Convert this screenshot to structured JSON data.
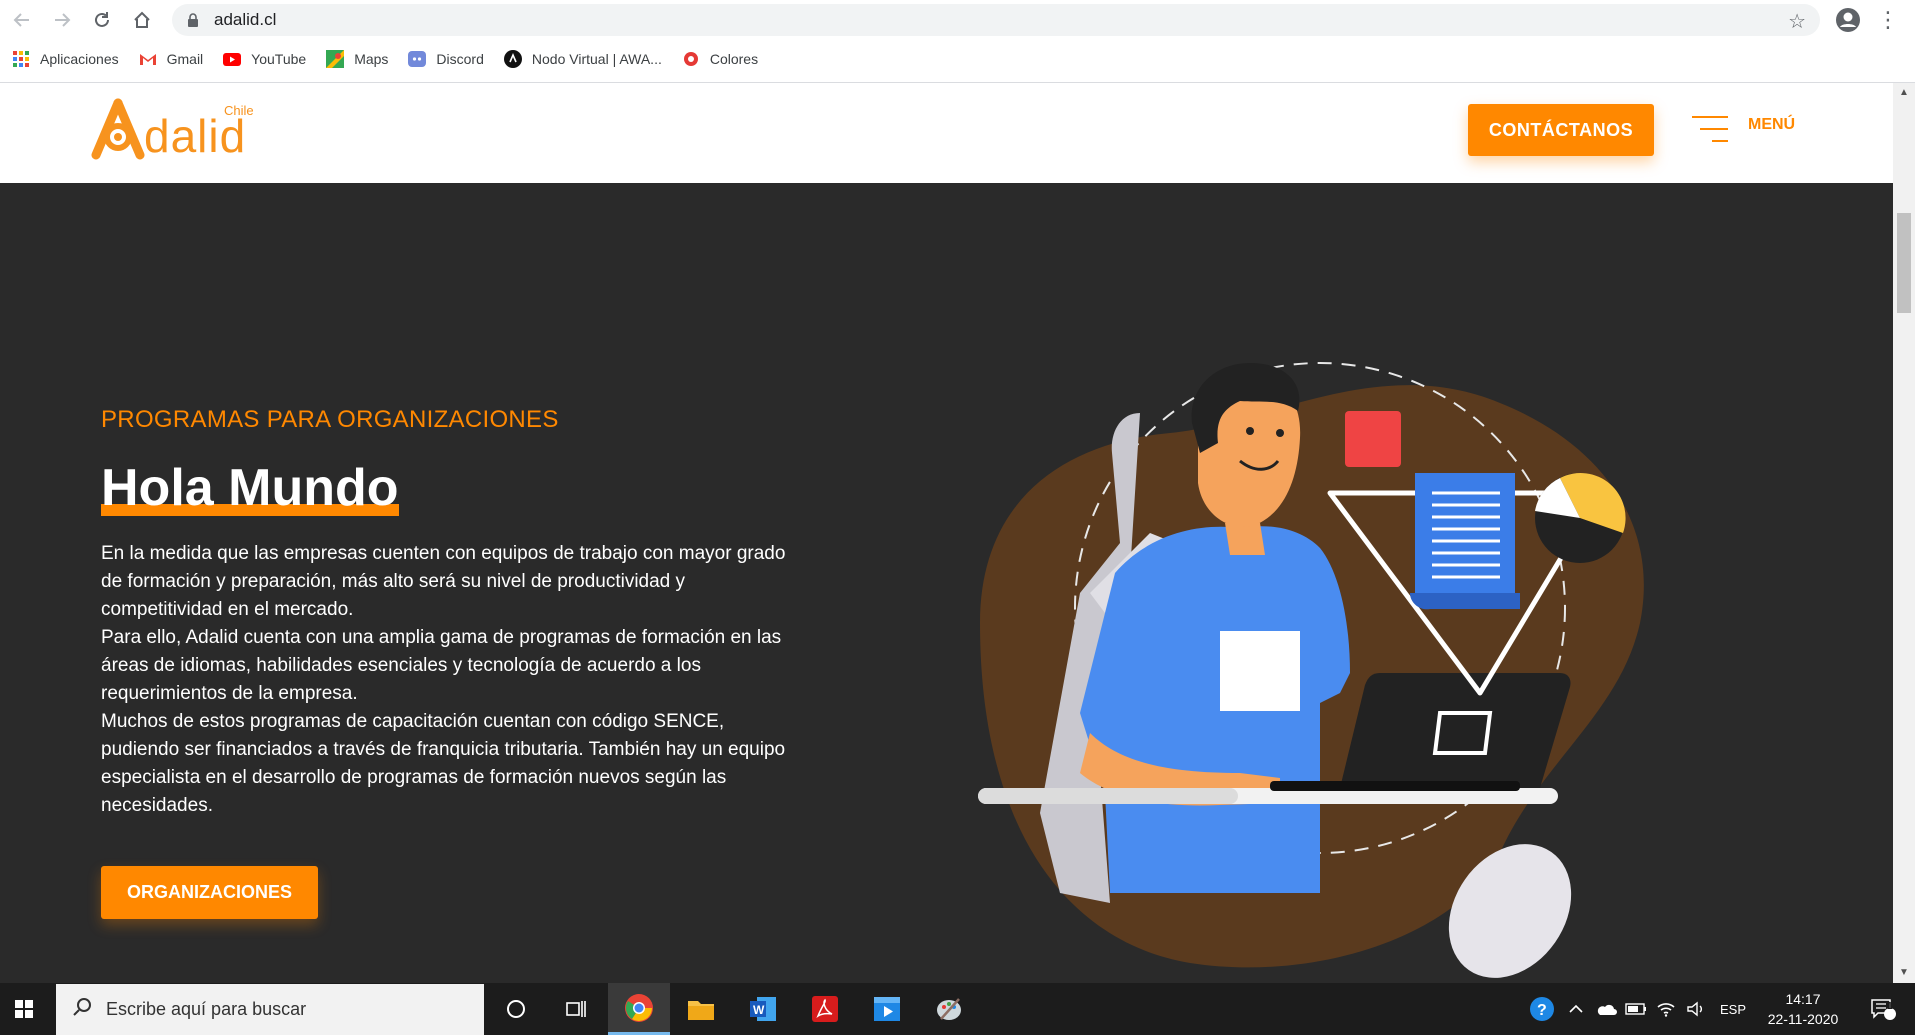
{
  "browser": {
    "url": "adalid.cl",
    "bookmarks": [
      {
        "label": "Aplicaciones",
        "icon": "apps-grid-icon"
      },
      {
        "label": "Gmail",
        "icon": "gmail-icon"
      },
      {
        "label": "YouTube",
        "icon": "youtube-icon"
      },
      {
        "label": "Maps",
        "icon": "maps-icon"
      },
      {
        "label": "Discord",
        "icon": "discord-icon"
      },
      {
        "label": "Nodo Virtual | AWA...",
        "icon": "nodo-virtual-icon"
      },
      {
        "label": "Colores",
        "icon": "colores-icon"
      }
    ]
  },
  "header": {
    "logo_word": "dalid",
    "logo_country": "Chile",
    "contact_label": "CONTÁCTANOS",
    "menu_label": "MENÚ"
  },
  "hero": {
    "eyebrow": "PROGRAMAS PARA ORGANIZACIONES",
    "title": "Hola Mundo",
    "paragraph_1": "En la medida que las empresas cuenten con equipos de trabajo con mayor grado de formación y preparación, más alto será su nivel de productividad y competitividad en el mercado.",
    "paragraph_2": "Para ello, Adalid cuenta con una amplia gama de programas de formación en las áreas de idiomas, habilidades esenciales y tecnología de acuerdo a los requerimientos de la empresa.",
    "paragraph_3": "Muchos de estos programas de capacitación cuentan con código SENCE, pudiendo ser financiados a través de franquicia tributaria. También hay un equipo especialista en el desarrollo de programas de formación nuevos según las necesidades.",
    "cta_label": "ORGANIZACIONES"
  },
  "taskbar": {
    "search_placeholder": "Escribe aquí para buscar",
    "language": "ESP",
    "time": "14:17",
    "date": "22-11-2020",
    "notification_count": "1"
  },
  "colors": {
    "accent": "#ff8800",
    "hero_background": "#2a2a2a",
    "illustration_blob": "#5a3a1e",
    "shirt_blue": "#4a8cf0"
  }
}
